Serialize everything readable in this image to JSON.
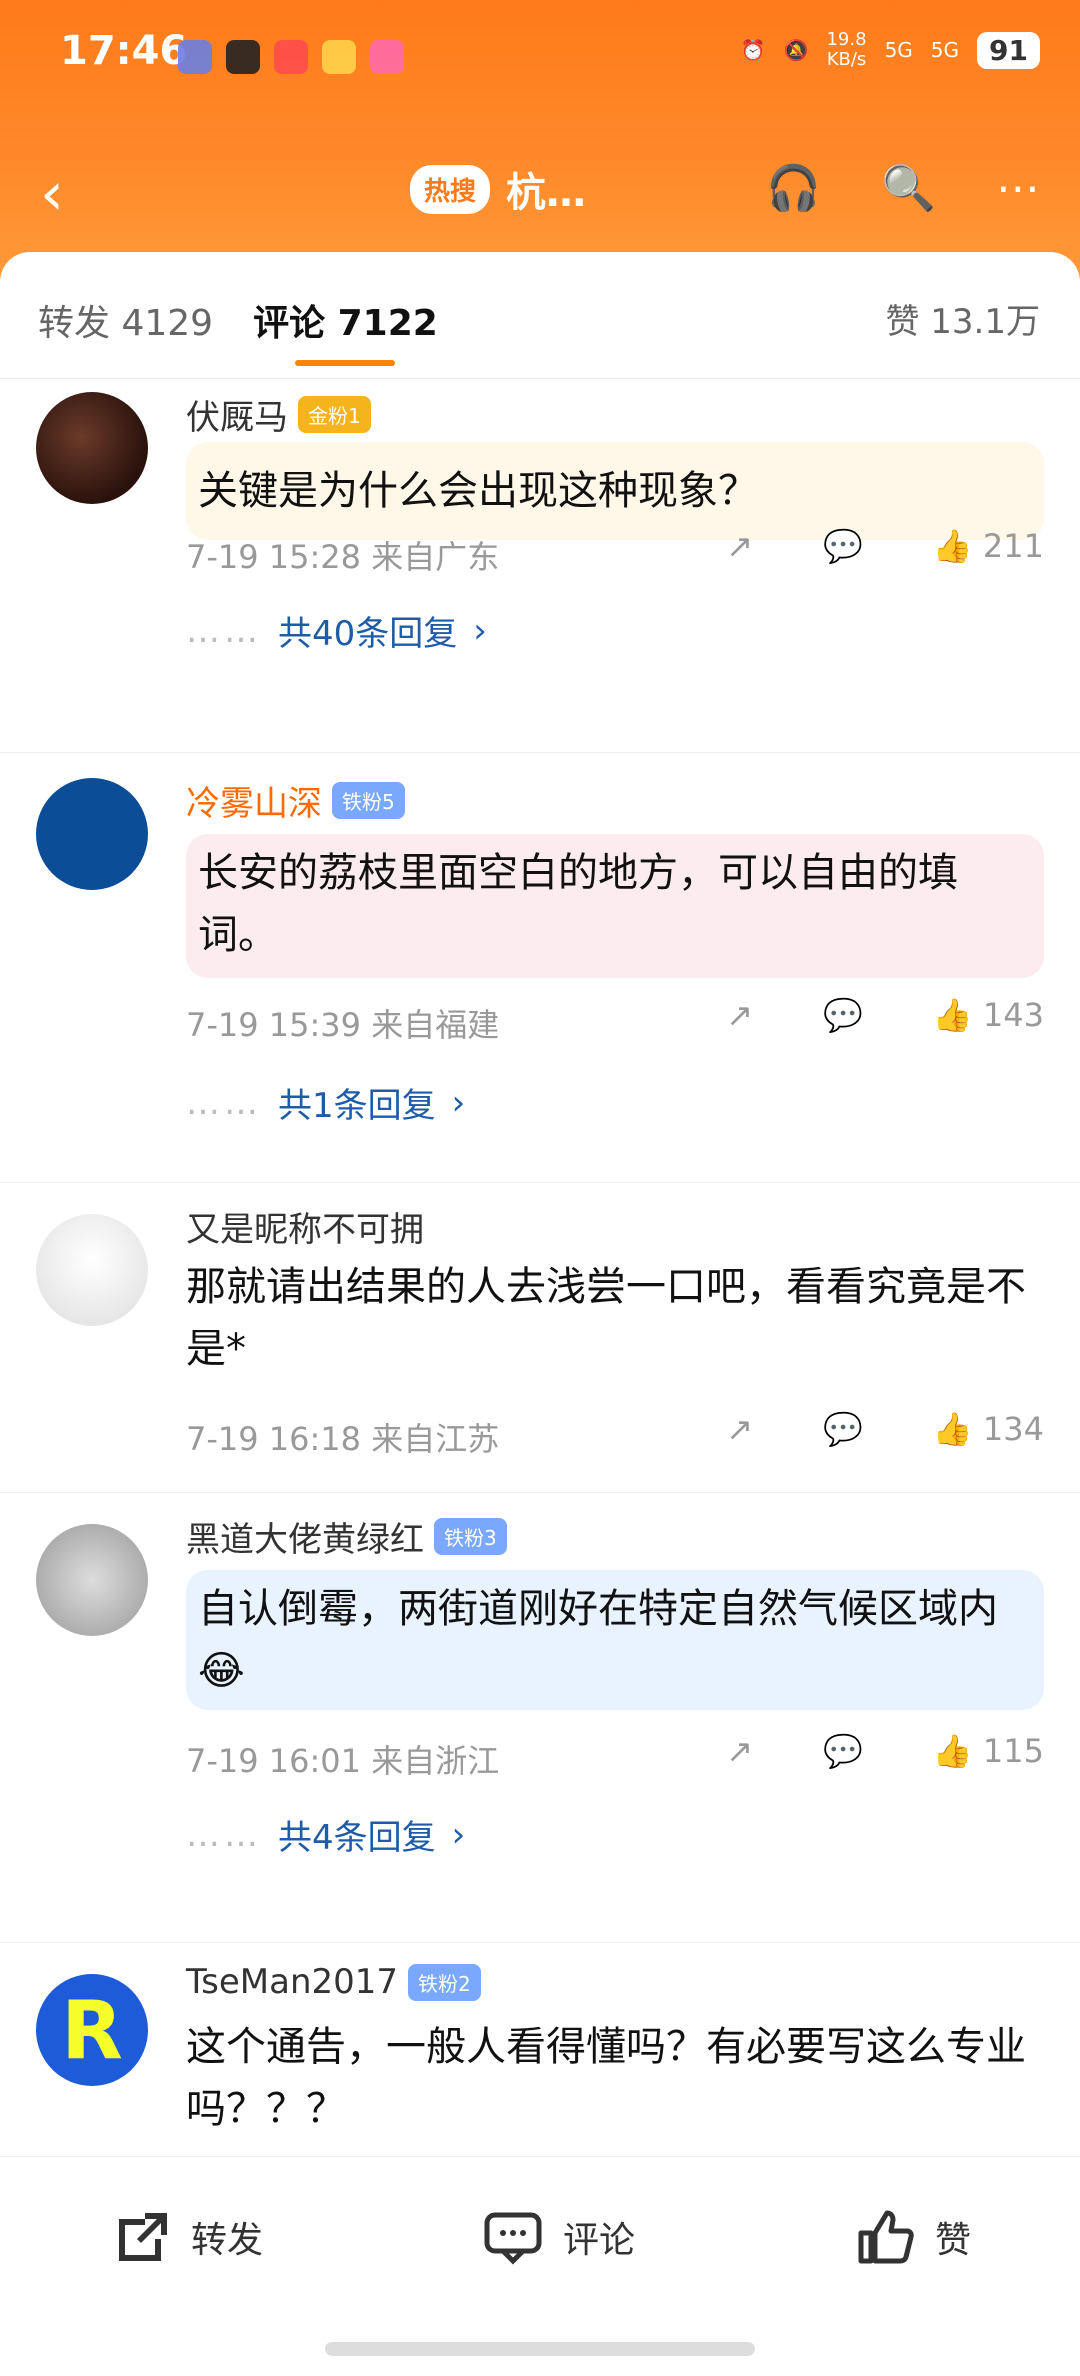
{
  "status": {
    "time": "17:46",
    "net_speed": "19.8",
    "net_unit": "KB/s",
    "signal1": "5G",
    "signal2": "5G",
    "battery": "91"
  },
  "nav": {
    "hot_badge": "热搜",
    "title": "杭…",
    "icons": [
      "back-icon",
      "headphones-icon",
      "search-icon",
      "more-icon"
    ]
  },
  "tabs": {
    "forward": "转发 4129",
    "comments": "评论 7122",
    "likes": "赞 13.1万"
  },
  "comments": [
    {
      "name": "伏厩马",
      "badge": "金粉1",
      "text": "关键是为什么会出现这种现象？",
      "time": "7-19 15:28 来自广东",
      "likes": "211",
      "replies": "共40条回复"
    },
    {
      "name": "冷雾山深",
      "badge": "铁粉5",
      "text": "长安的荔枝里面空白的地方，可以自由的填词。",
      "time": "7-19 15:39 来自福建",
      "likes": "143",
      "replies": "共1条回复"
    },
    {
      "name": "又是昵称不可拥",
      "badge": "",
      "text": "那就请出结果的人去浅尝一口吧，看看究竟是不是*",
      "time": "7-19 16:18 来自江苏",
      "likes": "134",
      "replies": ""
    },
    {
      "name": "黑道大佬黄绿红",
      "badge": "铁粉3",
      "text": "自认倒霉，两街道刚好在特定自然气候区域内😂",
      "time": "7-19 16:01 来自浙江",
      "likes": "115",
      "replies": "共4条回复"
    },
    {
      "name": "TseMan2017",
      "badge": "铁粉2",
      "text": "这个通告，一般人看得懂吗？有必要写这么专业吗？？？",
      "time": "",
      "likes": "",
      "replies": ""
    }
  ],
  "bottom": {
    "forward": "转发",
    "comment": "评论",
    "like": "赞"
  }
}
